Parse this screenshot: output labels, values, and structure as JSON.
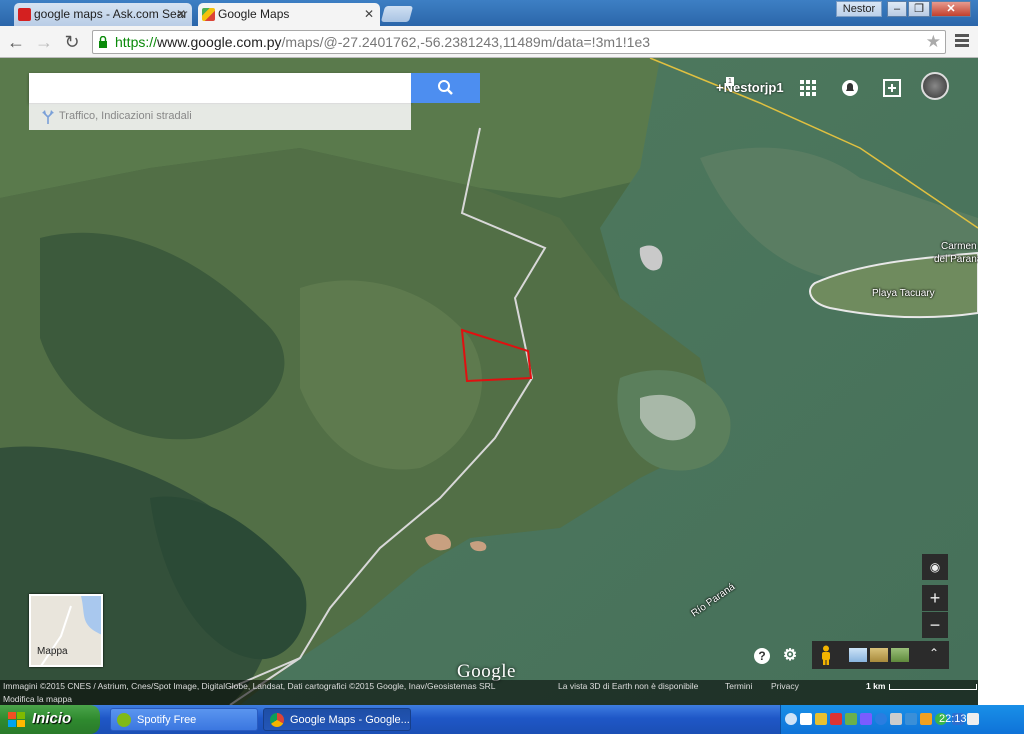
{
  "browser": {
    "tabs": [
      {
        "title": "google maps - Ask.com Sear",
        "icon": "ask-icon"
      },
      {
        "title": "Google Maps",
        "icon": "google-maps-icon",
        "active": true
      }
    ],
    "user": "Nestor",
    "window_controls": [
      "minimize",
      "restore",
      "close"
    ],
    "url": {
      "scheme": "https://",
      "host": "www.google.com.py",
      "path": "/maps/@-27.2401762,-56.2381243,11489m/data=!3m1!1e3"
    }
  },
  "maps": {
    "search": {
      "placeholder": "",
      "value": ""
    },
    "directions_text": "Traffico, Indicazioni stradali",
    "profile_name": "+Nestorjp1",
    "notification_count": "1",
    "labels": {
      "carmen_1": "Carmen",
      "carmen_2": "del Paraná",
      "playa": "Playa Tacuary",
      "rio": "Río Paraná"
    },
    "thumbnail_label": "Mappa",
    "logo": "Google",
    "footer": {
      "imagery": "Immagini ©2015 CNES / Astrium, Cnes/Spot Image, DigitalGlobe, Landsat, Dati cartografici ©2015 Google, Inav/Geosistemas SRL",
      "earth": "La vista 3D di Earth non è disponibile",
      "terms": "Termini",
      "privacy": "Privacy",
      "scale": "1 km",
      "edit": "Modifica la mappa"
    },
    "controls": {
      "zoom_in": "+",
      "zoom_out": "−",
      "help": "?"
    }
  },
  "taskbar": {
    "start": "Inicio",
    "items": [
      {
        "label": "Spotify Free",
        "icon": "spotify-icon"
      },
      {
        "label": "Google Maps - Google...",
        "icon": "chrome-icon",
        "active": true
      }
    ],
    "clock": "22:13"
  },
  "colors": {
    "map_search_button": "#4d8ef0",
    "taskbar": "#1f57c7",
    "start_button": "#2f8a2f",
    "selected_area_outline": "#e01010"
  }
}
